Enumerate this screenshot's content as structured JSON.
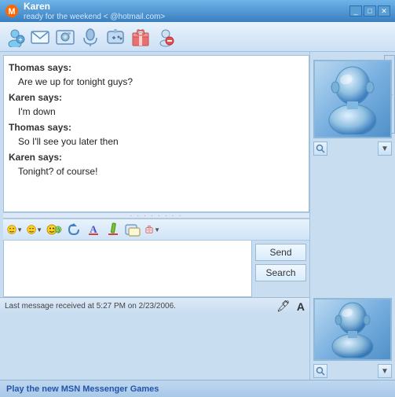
{
  "window": {
    "title": "Karen",
    "status": "ready for the weekend <",
    "email": "@hotmail.com>",
    "controls": [
      "_",
      "□",
      "✕"
    ]
  },
  "toolbar": {
    "icons": [
      {
        "name": "contact-icon",
        "symbol": "👤"
      },
      {
        "name": "email-icon",
        "symbol": "✉"
      },
      {
        "name": "camera-icon",
        "symbol": "📷"
      },
      {
        "name": "phone-icon",
        "symbol": "📞"
      },
      {
        "name": "msn-icon",
        "symbol": "🖥"
      },
      {
        "name": "gift-icon",
        "symbol": "🎁"
      },
      {
        "name": "block-icon",
        "symbol": "🚫"
      }
    ]
  },
  "messages": [
    {
      "sender": "Thomas says:",
      "text": "Are we up for tonight guys?"
    },
    {
      "sender": "Karen says:",
      "text": "I'm down"
    },
    {
      "sender": "Thomas says:",
      "text": "So I'll see you later then"
    },
    {
      "sender": "Karen says:",
      "text": "Tonight? of course!"
    }
  ],
  "format_toolbar": {
    "emoji_btn": "😊",
    "emoji2_btn": "😏",
    "emoji3_btn": "😂",
    "refresh_btn": "↺",
    "font_btn": "A",
    "pen_btn": "✏",
    "wink_btn": "📋",
    "nudge_btn": "🎁"
  },
  "buttons": {
    "send": "Send",
    "search": "Search"
  },
  "status_bar": {
    "text": "Last message received at 5:27 PM on 2/23/2006.",
    "icon1": "🖊",
    "icon2": "A"
  },
  "bottom_bar": {
    "text": "Play the new MSN Messenger Games"
  },
  "divider": {
    "dots": "· · · · · · · ·"
  }
}
